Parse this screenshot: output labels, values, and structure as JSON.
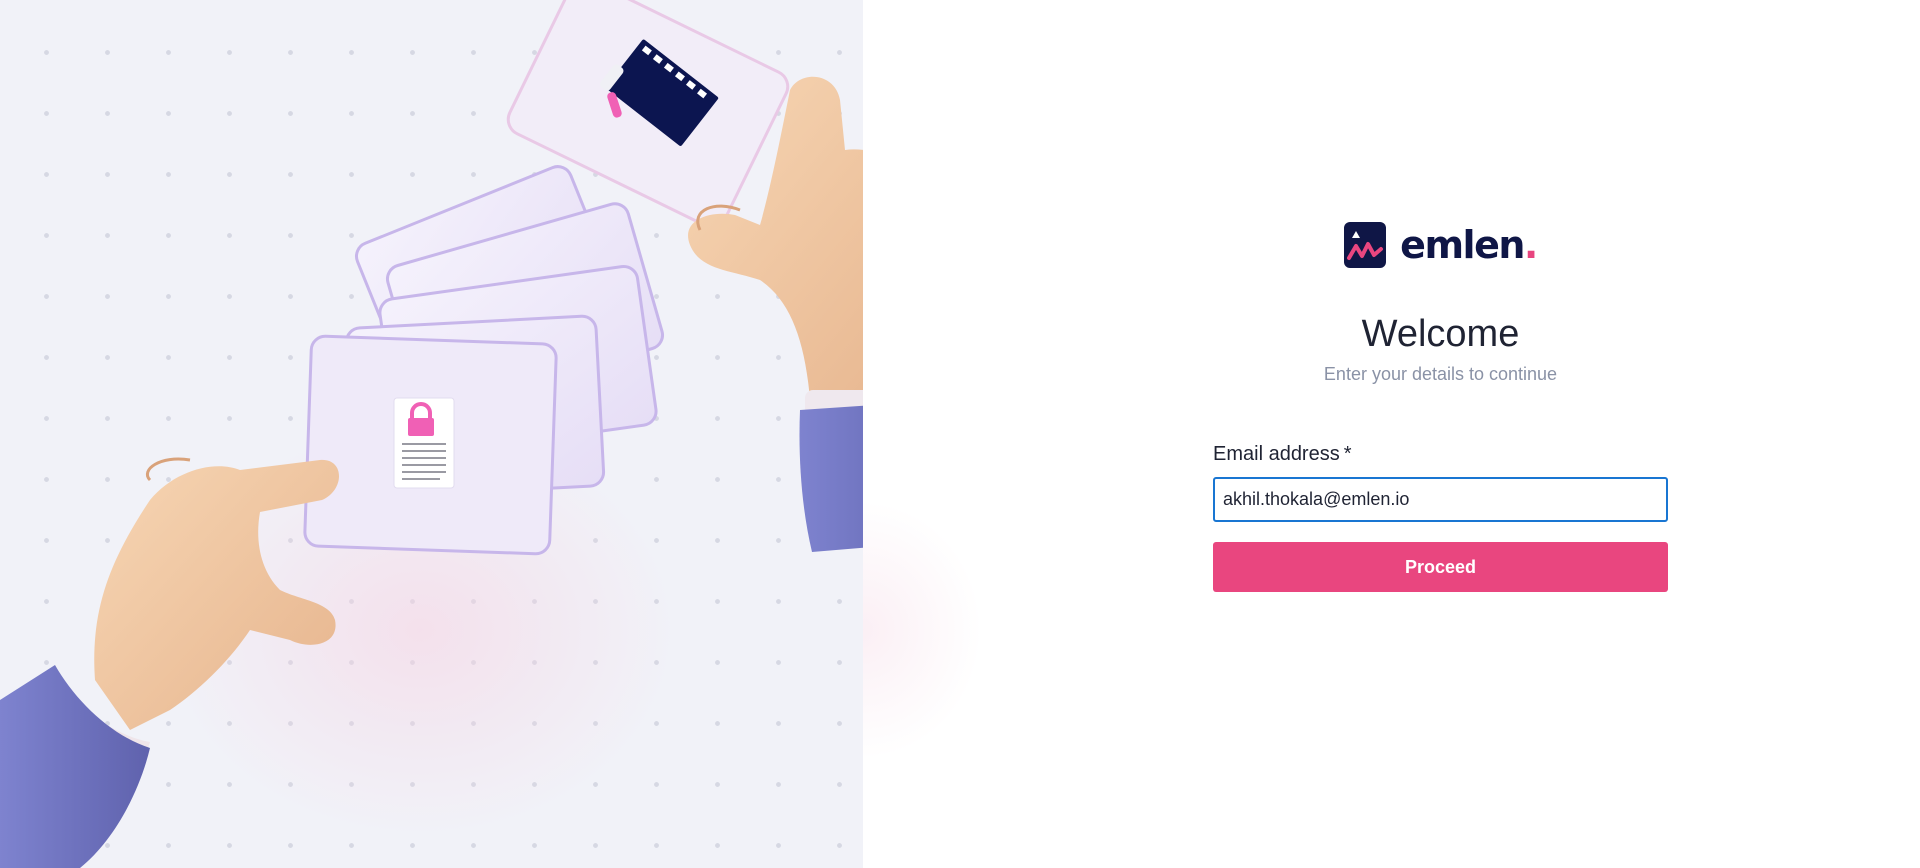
{
  "brand": {
    "name": "emlen",
    "dot": ".",
    "logo_icon": "emlen-logo-icon",
    "primary_color": "#e9467f",
    "dark_color": "#0f1646"
  },
  "hero": {
    "illustration": "hands-swapping-cards-illustration",
    "icons": [
      "lock-document-icon",
      "film-strip-icon"
    ]
  },
  "auth": {
    "title": "Welcome",
    "subtitle": "Enter your details to continue",
    "email_label": "Email address",
    "required_mark": "*",
    "email_value": "akhil.thokala@emlen.io",
    "proceed_label": "Proceed",
    "focus_color": "#1976d2"
  }
}
